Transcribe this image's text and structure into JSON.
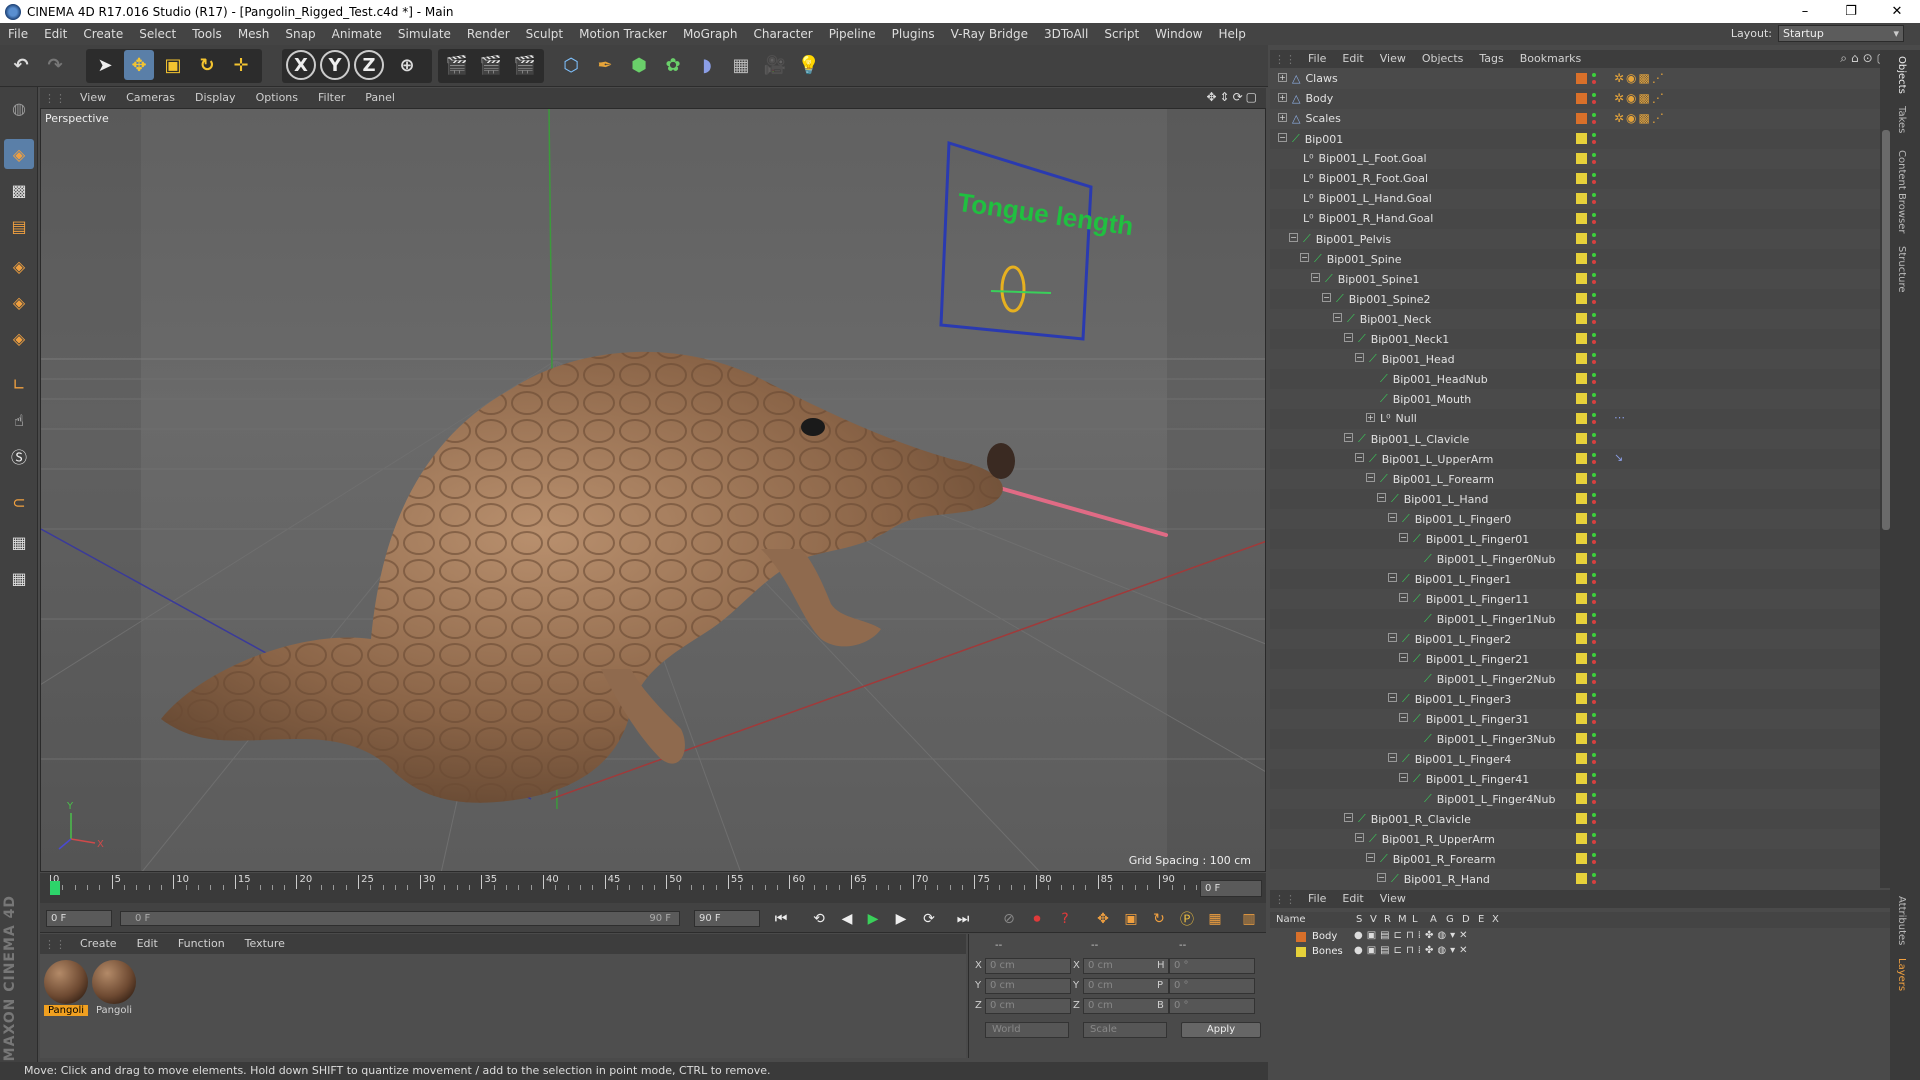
{
  "window": {
    "title": "CINEMA 4D R17.016 Studio (R17) - [Pangolin_Rigged_Test.c4d *] - Main",
    "controls": [
      "–",
      "❐",
      "✕"
    ]
  },
  "menubar": {
    "items": [
      "File",
      "Edit",
      "Create",
      "Select",
      "Tools",
      "Mesh",
      "Snap",
      "Animate",
      "Simulate",
      "Render",
      "Sculpt",
      "Motion Tracker",
      "MoGraph",
      "Character",
      "Pipeline",
      "Plugins",
      "V-Ray Bridge",
      "3DToAll",
      "Script",
      "Window",
      "Help"
    ],
    "layout_label": "Layout:",
    "layout_value": "Startup"
  },
  "viewport": {
    "menu": [
      "View",
      "Cameras",
      "Display",
      "Options",
      "Filter",
      "Panel"
    ],
    "camera_label": "Perspective",
    "grid_spacing": "Grid Spacing : 100 cm",
    "annotation_text": "Tongue length",
    "axis_y": "Y",
    "axis_x": "X"
  },
  "timeline": {
    "ticks": [
      "0",
      "5",
      "10",
      "15",
      "20",
      "25",
      "30",
      "35",
      "40",
      "45",
      "50",
      "55",
      "60",
      "65",
      "70",
      "75",
      "80",
      "85",
      "90"
    ],
    "current_frame_field": "0 F",
    "start_field": "0 F",
    "range_start": "0 F",
    "range_end": "90 F",
    "end_field": "90 F"
  },
  "material_manager": {
    "menu": [
      "Create",
      "Edit",
      "Function",
      "Texture"
    ],
    "materials": [
      {
        "label": "Pangoli"
      },
      {
        "label": "Pangoli"
      }
    ]
  },
  "coordinates": {
    "headers": [
      "--",
      "--",
      "--"
    ],
    "rows": [
      {
        "a": "X",
        "a_val": "0 cm",
        "b": "X",
        "b_val": "0 cm",
        "c": "H",
        "c_val": "0 °"
      },
      {
        "a": "Y",
        "a_val": "0 cm",
        "b": "Y",
        "b_val": "0 cm",
        "c": "P",
        "c_val": "0 °"
      },
      {
        "a": "Z",
        "a_val": "0 cm",
        "b": "Z",
        "b_val": "0 cm",
        "c": "B",
        "c_val": "0 °"
      }
    ],
    "mode_select": "World",
    "scale_select": "Scale",
    "apply": "Apply"
  },
  "status_text": "Move: Click and drag to move elements. Hold down SHIFT to quantize movement / add to the selection in point mode, CTRL to remove.",
  "object_manager": {
    "menu": [
      "File",
      "Edit",
      "View",
      "Objects",
      "Tags",
      "Bookmarks"
    ],
    "objects": [
      {
        "name": "Claws",
        "depth": 0,
        "icon": "poly",
        "layer": "#d9702a",
        "exp": "+"
      },
      {
        "name": "Body",
        "depth": 0,
        "icon": "poly",
        "layer": "#d9702a",
        "exp": "+"
      },
      {
        "name": "Scales",
        "depth": 0,
        "icon": "poly",
        "layer": "#d9702a",
        "exp": "+"
      },
      {
        "name": "Bip001",
        "depth": 0,
        "icon": "bone",
        "layer": "#e6d13a",
        "exp": "−"
      },
      {
        "name": "Bip001_L_Foot.Goal",
        "depth": 1,
        "icon": "null",
        "layer": "#e6d13a",
        "exp": ""
      },
      {
        "name": "Bip001_R_Foot.Goal",
        "depth": 1,
        "icon": "null",
        "layer": "#e6d13a",
        "exp": ""
      },
      {
        "name": "Bip001_L_Hand.Goal",
        "depth": 1,
        "icon": "null",
        "layer": "#e6d13a",
        "exp": ""
      },
      {
        "name": "Bip001_R_Hand.Goal",
        "depth": 1,
        "icon": "null",
        "layer": "#e6d13a",
        "exp": ""
      },
      {
        "name": "Bip001_Pelvis",
        "depth": 1,
        "icon": "bone",
        "layer": "#e6d13a",
        "exp": "−"
      },
      {
        "name": "Bip001_Spine",
        "depth": 2,
        "icon": "bone",
        "layer": "#e6d13a",
        "exp": "−"
      },
      {
        "name": "Bip001_Spine1",
        "depth": 3,
        "icon": "bone",
        "layer": "#e6d13a",
        "exp": "−"
      },
      {
        "name": "Bip001_Spine2",
        "depth": 4,
        "icon": "bone",
        "layer": "#e6d13a",
        "exp": "−"
      },
      {
        "name": "Bip001_Neck",
        "depth": 5,
        "icon": "bone",
        "layer": "#e6d13a",
        "exp": "−"
      },
      {
        "name": "Bip001_Neck1",
        "depth": 6,
        "icon": "bone",
        "layer": "#e6d13a",
        "exp": "−"
      },
      {
        "name": "Bip001_Head",
        "depth": 7,
        "icon": "bone",
        "layer": "#e6d13a",
        "exp": "−"
      },
      {
        "name": "Bip001_HeadNub",
        "depth": 8,
        "icon": "bone",
        "layer": "#e6d13a",
        "exp": ""
      },
      {
        "name": "Bip001_Mouth",
        "depth": 8,
        "icon": "bone",
        "layer": "#e6d13a",
        "exp": ""
      },
      {
        "name": "Null",
        "depth": 8,
        "icon": "null",
        "layer": "#e6d13a",
        "exp": "+"
      },
      {
        "name": "Bip001_L_Clavicle",
        "depth": 6,
        "icon": "bone",
        "layer": "#e6d13a",
        "exp": "−"
      },
      {
        "name": "Bip001_L_UpperArm",
        "depth": 7,
        "icon": "bone",
        "layer": "#e6d13a",
        "exp": "−"
      },
      {
        "name": "Bip001_L_Forearm",
        "depth": 8,
        "icon": "bone",
        "layer": "#e6d13a",
        "exp": "−"
      },
      {
        "name": "Bip001_L_Hand",
        "depth": 9,
        "icon": "bone",
        "layer": "#e6d13a",
        "exp": "−"
      },
      {
        "name": "Bip001_L_Finger0",
        "depth": 10,
        "icon": "bone",
        "layer": "#e6d13a",
        "exp": "−"
      },
      {
        "name": "Bip001_L_Finger01",
        "depth": 11,
        "icon": "bone",
        "layer": "#e6d13a",
        "exp": "−"
      },
      {
        "name": "Bip001_L_Finger0Nub",
        "depth": 12,
        "icon": "bone",
        "layer": "#e6d13a",
        "exp": ""
      },
      {
        "name": "Bip001_L_Finger1",
        "depth": 10,
        "icon": "bone",
        "layer": "#e6d13a",
        "exp": "−"
      },
      {
        "name": "Bip001_L_Finger11",
        "depth": 11,
        "icon": "bone",
        "layer": "#e6d13a",
        "exp": "−"
      },
      {
        "name": "Bip001_L_Finger1Nub",
        "depth": 12,
        "icon": "bone",
        "layer": "#e6d13a",
        "exp": ""
      },
      {
        "name": "Bip001_L_Finger2",
        "depth": 10,
        "icon": "bone",
        "layer": "#e6d13a",
        "exp": "−"
      },
      {
        "name": "Bip001_L_Finger21",
        "depth": 11,
        "icon": "bone",
        "layer": "#e6d13a",
        "exp": "−"
      },
      {
        "name": "Bip001_L_Finger2Nub",
        "depth": 12,
        "icon": "bone",
        "layer": "#e6d13a",
        "exp": ""
      },
      {
        "name": "Bip001_L_Finger3",
        "depth": 10,
        "icon": "bone",
        "layer": "#e6d13a",
        "exp": "−"
      },
      {
        "name": "Bip001_L_Finger31",
        "depth": 11,
        "icon": "bone",
        "layer": "#e6d13a",
        "exp": "−"
      },
      {
        "name": "Bip001_L_Finger3Nub",
        "depth": 12,
        "icon": "bone",
        "layer": "#e6d13a",
        "exp": ""
      },
      {
        "name": "Bip001_L_Finger4",
        "depth": 10,
        "icon": "bone",
        "layer": "#e6d13a",
        "exp": "−"
      },
      {
        "name": "Bip001_L_Finger41",
        "depth": 11,
        "icon": "bone",
        "layer": "#e6d13a",
        "exp": "−"
      },
      {
        "name": "Bip001_L_Finger4Nub",
        "depth": 12,
        "icon": "bone",
        "layer": "#e6d13a",
        "exp": ""
      },
      {
        "name": "Bip001_R_Clavicle",
        "depth": 6,
        "icon": "bone",
        "layer": "#e6d13a",
        "exp": "−"
      },
      {
        "name": "Bip001_R_UpperArm",
        "depth": 7,
        "icon": "bone",
        "layer": "#e6d13a",
        "exp": "−"
      },
      {
        "name": "Bip001_R_Forearm",
        "depth": 8,
        "icon": "bone",
        "layer": "#e6d13a",
        "exp": "−"
      },
      {
        "name": "Bip001_R_Hand",
        "depth": 9,
        "icon": "bone",
        "layer": "#e6d13a",
        "exp": "−"
      }
    ]
  },
  "right_tabs": [
    "Objects",
    "Takes",
    "Content Browser",
    "Structure"
  ],
  "right_tabs_lower": [
    "Attributes",
    "Layers"
  ],
  "layer_manager": {
    "menu": [
      "File",
      "Edit",
      "View"
    ],
    "columns": [
      "Name",
      "S",
      "V",
      "R",
      "M",
      "L",
      "A",
      "G",
      "D",
      "E",
      "X"
    ],
    "layers": [
      {
        "name": "Body",
        "color": "#d9702a"
      },
      {
        "name": "Bones",
        "color": "#e6d13a"
      }
    ]
  }
}
